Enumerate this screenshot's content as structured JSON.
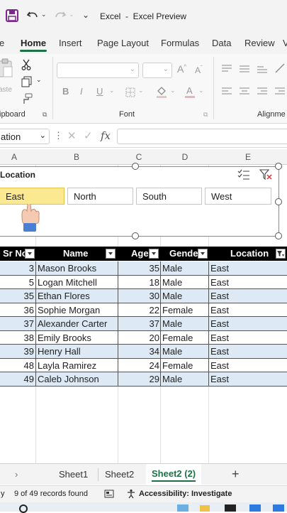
{
  "titlebar": {
    "title": "Excel  -  Excel Preview"
  },
  "tabs": [
    {
      "label": "e"
    },
    {
      "label": "Home"
    },
    {
      "label": "Insert"
    },
    {
      "label": "Page Layout"
    },
    {
      "label": "Formulas"
    },
    {
      "label": "Data"
    },
    {
      "label": "Review"
    },
    {
      "label": "V"
    }
  ],
  "ribbon": {
    "paste_label": "aste",
    "clipboard_label": "ipboard",
    "font_label": "Font",
    "alignment_label": "Alignme",
    "bold": "B",
    "italic": "I",
    "underline": "U"
  },
  "formula_bar": {
    "name_box": "ation",
    "fx": "fx",
    "formula": ""
  },
  "columns": [
    "A",
    "B",
    "C",
    "D",
    "E"
  ],
  "slicer": {
    "title": "Location",
    "buttons": [
      {
        "label": "East",
        "selected": true
      },
      {
        "label": "North",
        "selected": false
      },
      {
        "label": "South",
        "selected": false
      },
      {
        "label": "West",
        "selected": false
      }
    ]
  },
  "table": {
    "headers": [
      "Sr No",
      "Name",
      "Age",
      "Gende",
      "Location"
    ],
    "rows": [
      {
        "sr": "3",
        "name": "Mason Brooks",
        "age": "35",
        "gender": "Male",
        "location": "East"
      },
      {
        "sr": "5",
        "name": "Logan Mitchell",
        "age": "18",
        "gender": "Male",
        "location": "East"
      },
      {
        "sr": "35",
        "name": "Ethan Flores",
        "age": "30",
        "gender": "Male",
        "location": "East"
      },
      {
        "sr": "36",
        "name": "Sophie Morgan",
        "age": "22",
        "gender": "Female",
        "location": "East"
      },
      {
        "sr": "37",
        "name": "Alexander Carter",
        "age": "37",
        "gender": "Male",
        "location": "East"
      },
      {
        "sr": "38",
        "name": "Emily Brooks",
        "age": "20",
        "gender": "Female",
        "location": "East"
      },
      {
        "sr": "39",
        "name": "Henry Hall",
        "age": "34",
        "gender": "Male",
        "location": "East"
      },
      {
        "sr": "48",
        "name": "Layla Ramirez",
        "age": "24",
        "gender": "Female",
        "location": "East"
      },
      {
        "sr": "49",
        "name": "Caleb Johnson",
        "age": "29",
        "gender": "Male",
        "location": "East"
      }
    ]
  },
  "sheet_tabs": [
    {
      "label": "Sheet1",
      "active": false
    },
    {
      "label": "Sheet2",
      "active": false
    },
    {
      "label": "Sheet2 (2)",
      "active": true
    }
  ],
  "add_sheet": "+",
  "status": {
    "left": "y",
    "records": "9 of 49 records found",
    "accessibility": "Accessibility: Investigate"
  },
  "colors": {
    "accent": "#1e7145",
    "selected_slicer": "#fbe992",
    "band": "#dde9f5"
  }
}
